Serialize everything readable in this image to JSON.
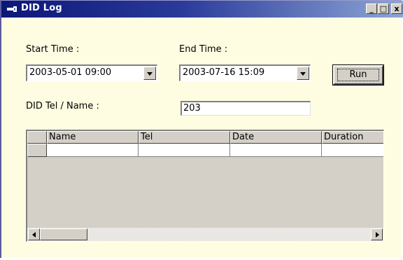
{
  "window": {
    "title": "DID Log"
  },
  "titlebar": {
    "minimize_glyph": "_",
    "maximize_glyph": "□",
    "close_glyph": "x"
  },
  "labels": {
    "start_time": "Start Time :",
    "end_time": "End Time :",
    "did_tel_name": "DID Tel / Name :"
  },
  "start_time": {
    "value": "2003-05-01 09:00"
  },
  "end_time": {
    "value": "2003-07-16 15:09"
  },
  "run_button": {
    "label": "Run"
  },
  "did_input": {
    "value": "203"
  },
  "grid": {
    "columns": [
      "Name",
      "Tel",
      "Date",
      "Duration"
    ],
    "rows": [
      [
        "",
        "",
        "",
        ""
      ]
    ]
  },
  "colors": {
    "window_bg": "#fefde2",
    "titlebar_start": "#0c1778",
    "titlebar_end": "#8fa6d6",
    "control_face": "#d4d0c8"
  },
  "icons": [
    "app-icon",
    "minimize-icon",
    "maximize-icon",
    "close-icon",
    "chevron-down-icon",
    "scroll-left-icon",
    "scroll-right-icon"
  ]
}
